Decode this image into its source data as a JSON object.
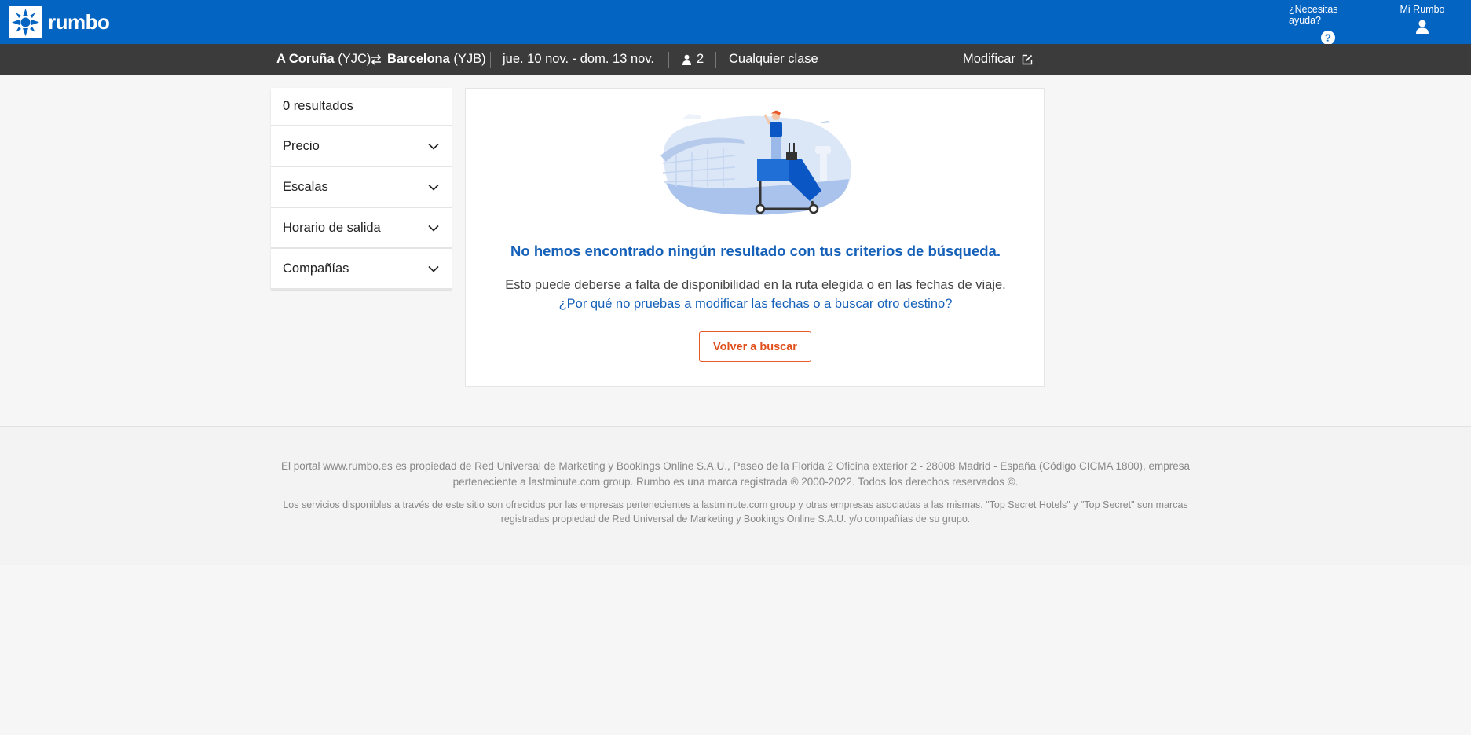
{
  "header": {
    "brand": "rumbo",
    "help_label": "¿Necesitas ayuda?",
    "account_label": "Mi Rumbo",
    "color": "#0464c2"
  },
  "search_summary": {
    "origin_city": "A Coruña",
    "origin_code": "(YJC)",
    "destination_city": "Barcelona",
    "destination_code": "(YJB)",
    "dates": "jue. 10 nov. - dom. 13 nov.",
    "passengers": "2",
    "cabin_class": "Cualquier clase",
    "modify_label": "Modificar"
  },
  "filters": {
    "results_count": "0 resultados",
    "items": [
      {
        "label": "Precio"
      },
      {
        "label": "Escalas"
      },
      {
        "label": "Horario de salida"
      },
      {
        "label": "Compañías"
      }
    ]
  },
  "empty_state": {
    "title": "No hemos encontrado ningún resultado con tus criterios de búsqueda.",
    "description": "Esto puede deberse a falta de disponibilidad en la ruta elegida o en las fechas de viaje.",
    "suggestion_link": "¿Por qué no pruebas a modificar las fechas o a buscar otro destino?",
    "retry_button": "Volver a buscar",
    "accent_color": "#1560b8",
    "button_color": "#e04e1b"
  },
  "footer": {
    "legal_1": "El portal www.rumbo.es es propiedad de Red Universal de Marketing y Bookings Online S.A.U., Paseo de la Florida 2 Oficina exterior 2 - 28008 Madrid - España (Código CICMA 1800), empresa perteneciente a lastminute.com group. Rumbo es una marca registrada ® 2000-2022. Todos los derechos reservados ©.",
    "legal_2": "Los servicios disponibles a través de este sitio son ofrecidos por las empresas pertenecientes a lastminute.com group y otras empresas asociadas a las mismas. \"Top Secret Hotels\" y \"Top Secret\" son marcas registradas propiedad de Red Universal de Marketing y Bookings Online S.A.U. y/o compañías de su grupo."
  },
  "icons": [
    "rumbo-logo-icon",
    "help-icon",
    "user-icon",
    "swap-arrows-icon",
    "passenger-icon",
    "edit-icon",
    "chevron-down-icon"
  ]
}
